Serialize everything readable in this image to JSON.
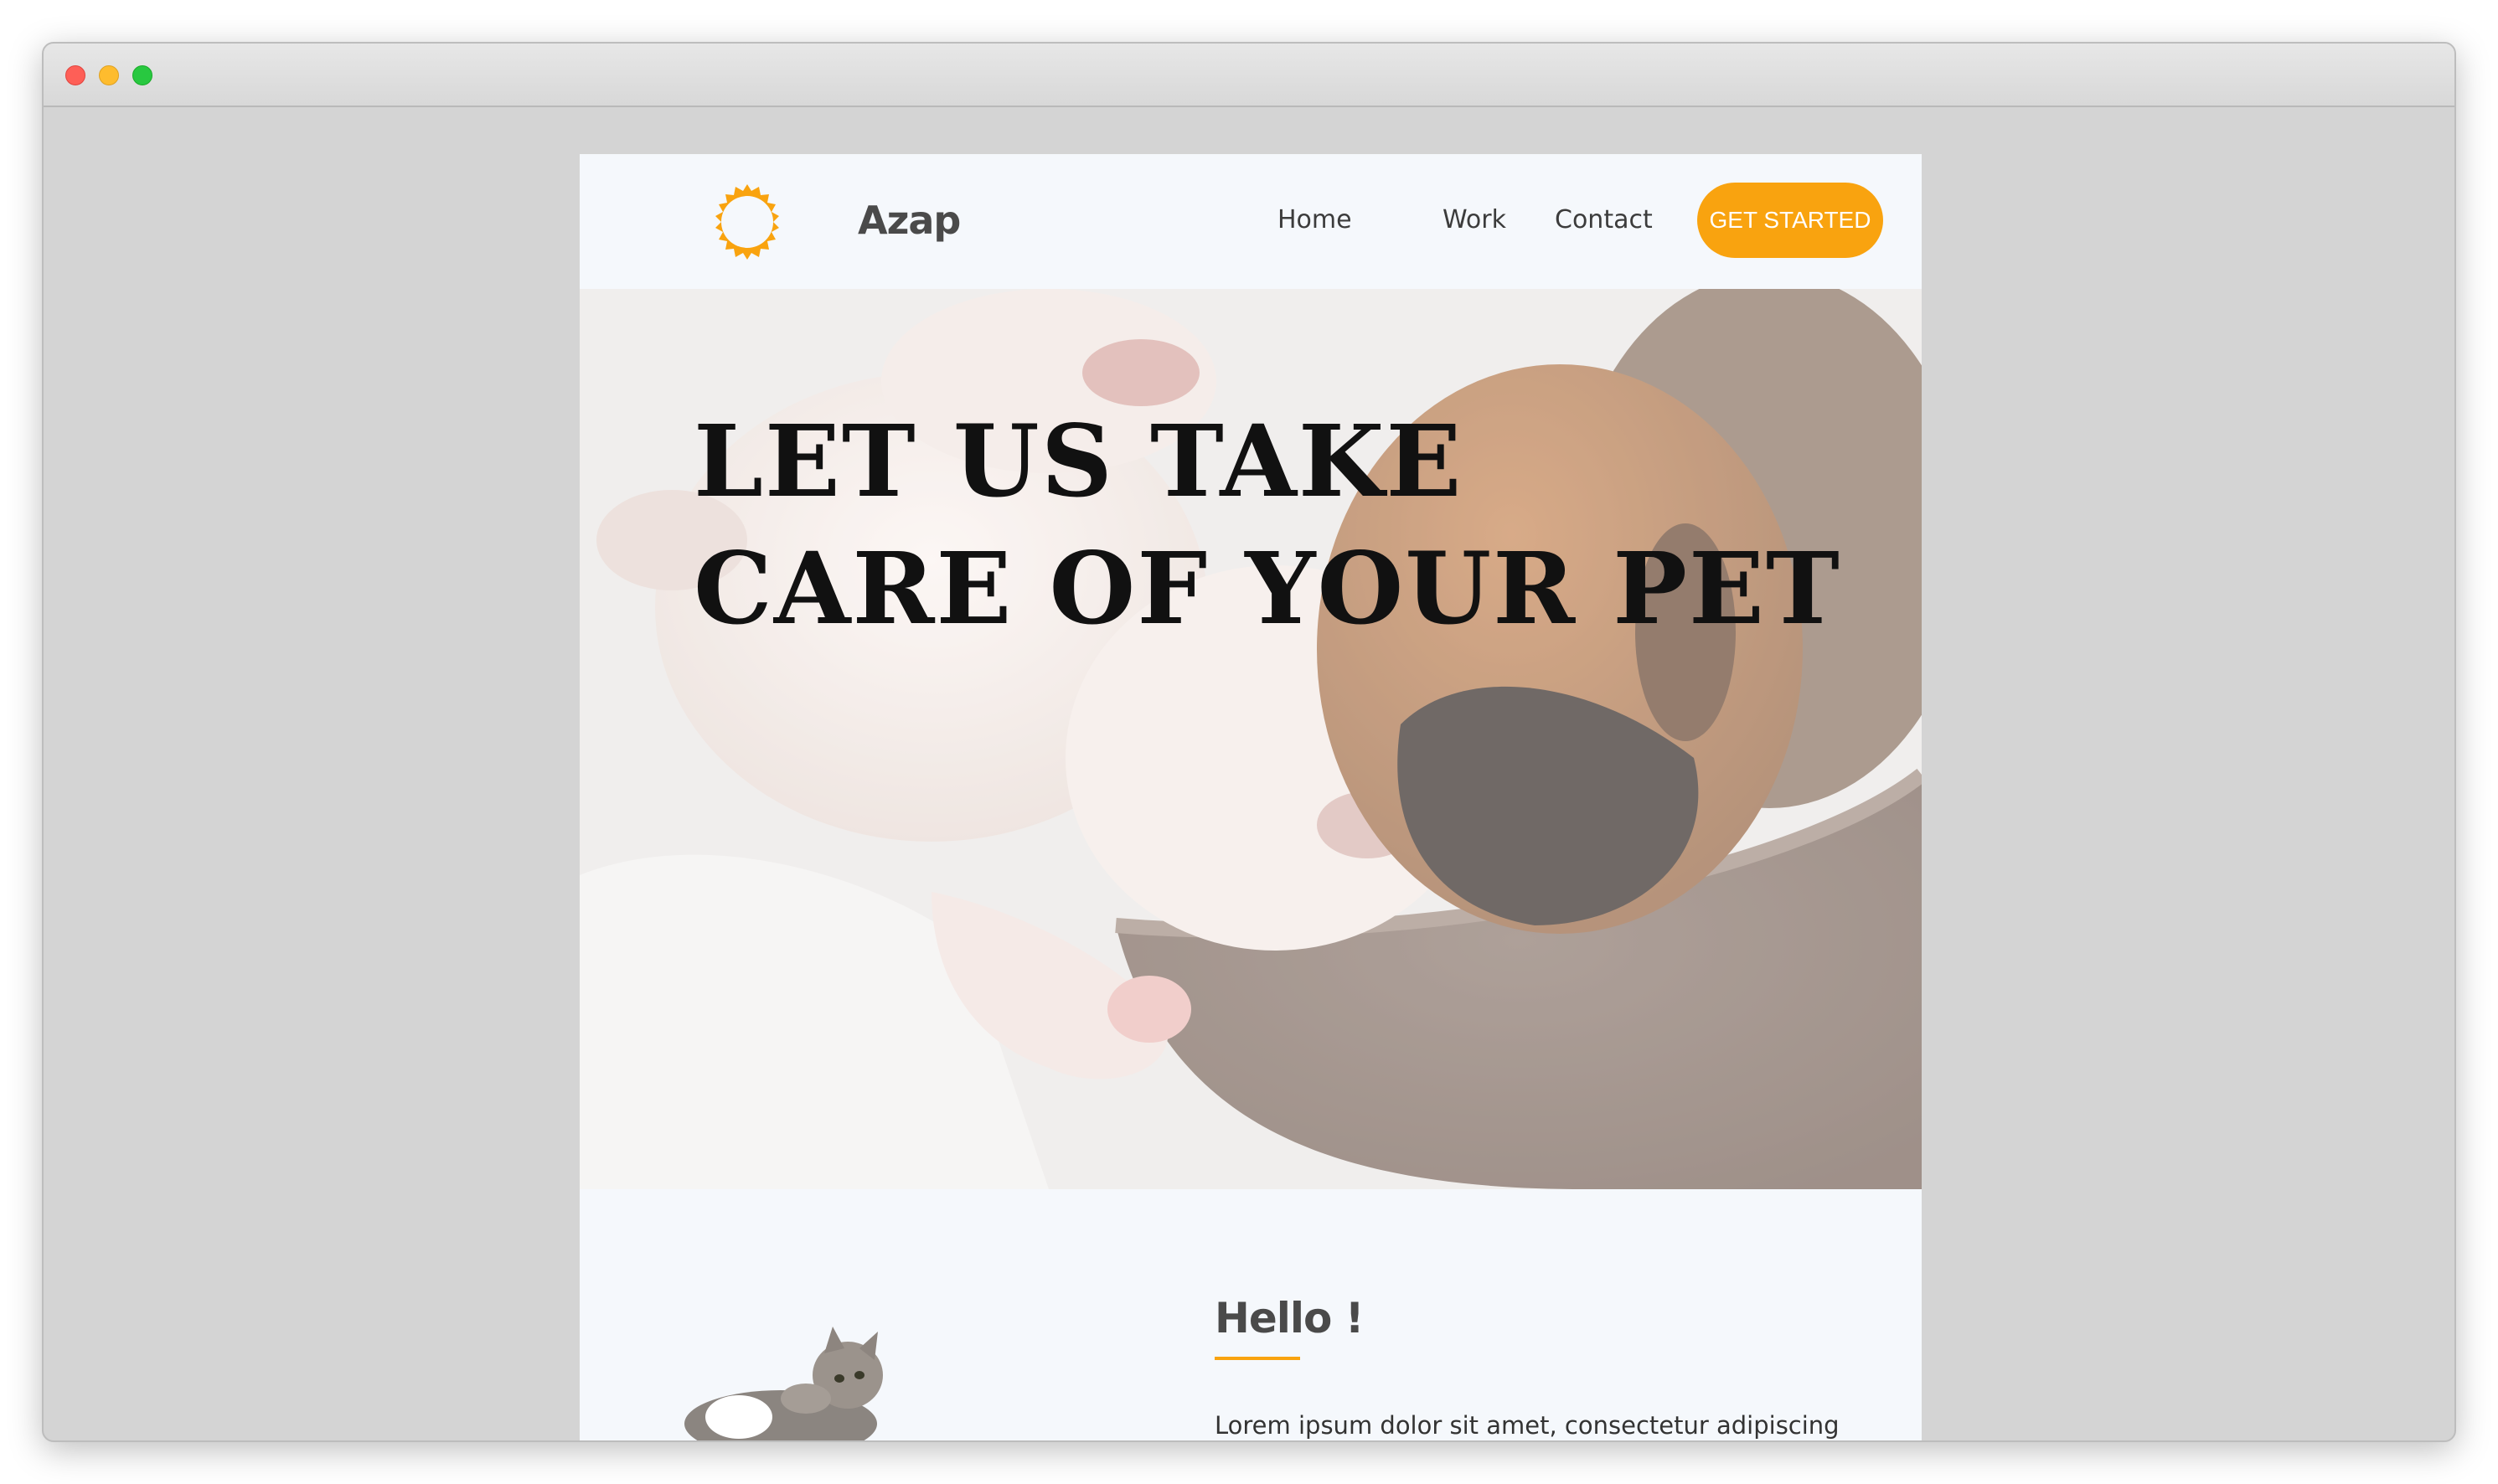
{
  "window": {
    "controls": [
      "close",
      "minimize",
      "maximize"
    ]
  },
  "navbar": {
    "logo_icon": "sun-ring-icon",
    "brand": "Azap",
    "links": [
      {
        "label": "Home"
      },
      {
        "label": "Work"
      },
      {
        "label": "Contact"
      }
    ],
    "cta_label": "GET STARTED"
  },
  "hero": {
    "heading_line1": "LET US TAKE",
    "heading_line2": "CARE OF YOUR PET",
    "image": "sleeping-puppies-in-bowl"
  },
  "about": {
    "heading": "Hello !",
    "text": "Lorem ipsum dolor sit amet, consectetur adipiscing",
    "image": "kitten-lying"
  },
  "colors": {
    "accent": "#f9a30f",
    "page_bg": "#f5f8fc",
    "window_bg": "#d4d4d4",
    "heading_text": "#4a4a4a"
  }
}
